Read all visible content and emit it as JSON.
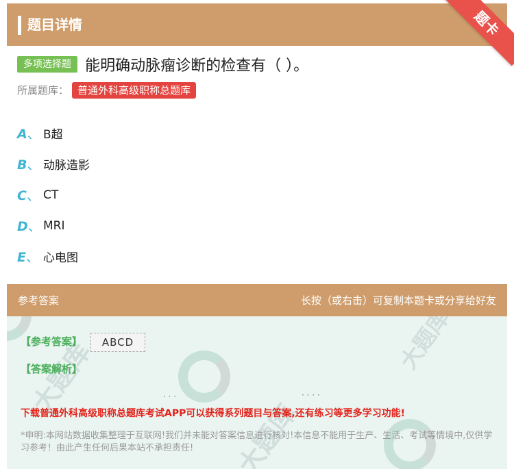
{
  "header": {
    "title": "题目详情",
    "corner_label": "题卡"
  },
  "question": {
    "type_label": "多项选择题",
    "text": "能明确动脉瘤诊断的检查有（ ）。",
    "bank_label": "所属题库：",
    "bank_name": "普通外科高级职称总题库"
  },
  "options": [
    {
      "letter": "A",
      "sep": "、",
      "text": "B超"
    },
    {
      "letter": "B",
      "sep": "、",
      "text": "动脉造影"
    },
    {
      "letter": "C",
      "sep": "、",
      "text": "CT"
    },
    {
      "letter": "D",
      "sep": "、",
      "text": "MRI"
    },
    {
      "letter": "E",
      "sep": "、",
      "text": "心电图"
    }
  ],
  "answer": {
    "section_title": "参考答案",
    "share_hint": "长按（或右击）可复制本题卡或分享给好友",
    "answer_label": "【参考答案】",
    "answer_value": "ABCD",
    "analysis_label": "【答案解析】",
    "promo": "下载普通外科高级职称总题库考试APP可以获得系列题目与答案,还有练习等更多学习功能!",
    "disclaimer": "*申明:本网站数据收集整理于互联网!我们并未能对答案信息进行核对!本信息不能用于生产、生活、考试等情境中,仅供学习参考！由此产生任何后果本站不承担责任!"
  },
  "colors": {
    "header_bg": "#cf9d6c",
    "tag_green": "#77c054",
    "tag_red": "#e4443f",
    "option_letter": "#3fb5d4",
    "answer_bg": "#eaf5f2"
  }
}
